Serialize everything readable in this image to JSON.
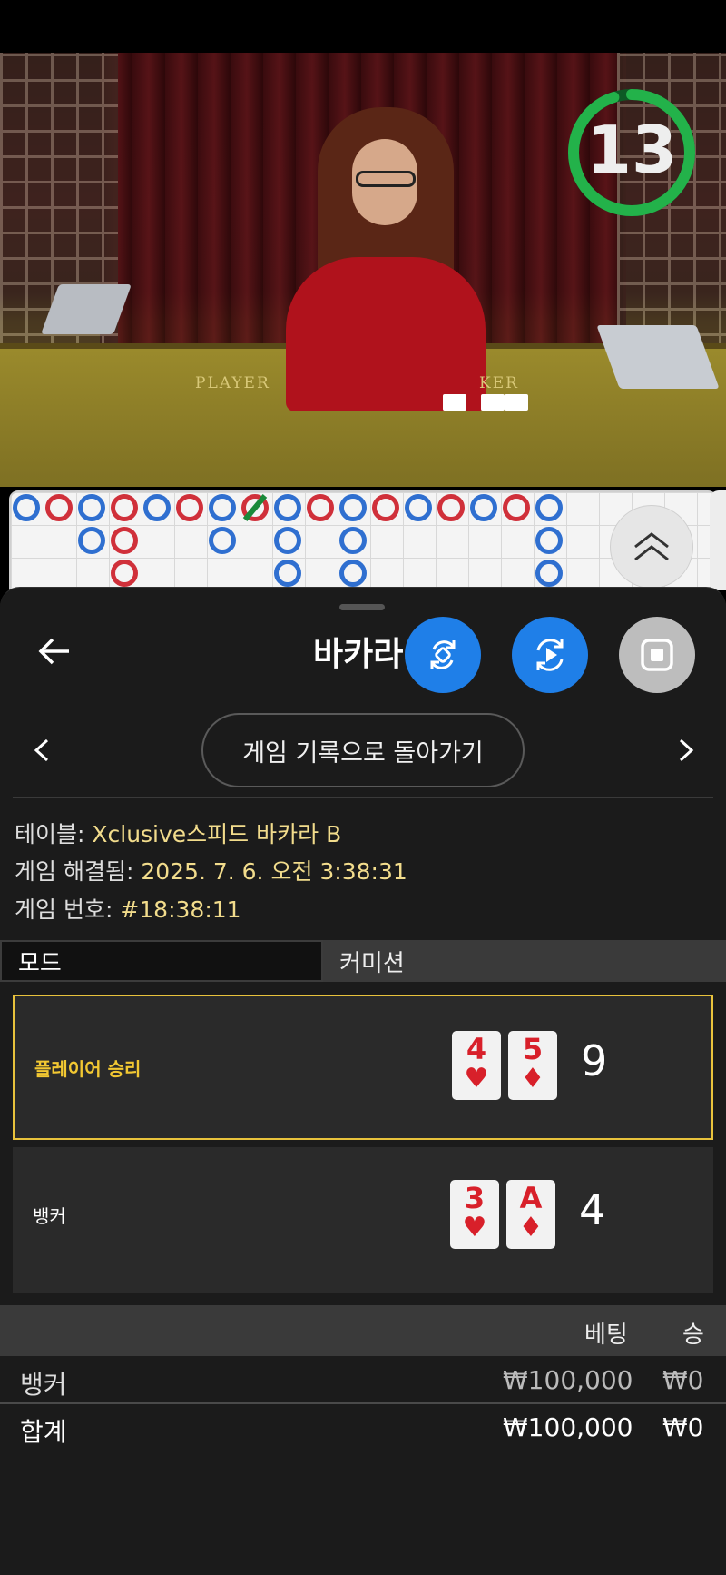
{
  "video": {
    "countdown": "13",
    "countdown_fraction": 0.95,
    "felt_player": "PLAYER",
    "felt_banker": "KER"
  },
  "roadmap": {
    "colors": {
      "player": "#2f6fd0",
      "banker": "#d0303a",
      "tie": "#1a8a3a"
    }
  },
  "panel": {
    "title": "바카라",
    "history_button": "게임 기록으로 돌아가기",
    "info": {
      "table_label": "테이블: ",
      "table_value": "Xclusive스피드 바카라 B",
      "resolved_label": "게임 해결됨: ",
      "resolved_value": "2025. 7. 6. 오전 3:38:31",
      "number_label": "게임 번호: ",
      "number_value": "#18:38:11"
    },
    "tabs": {
      "mode": "모드",
      "commission": "커미션"
    },
    "player_hand": {
      "label": "플레이어 승리",
      "cards": [
        {
          "rank": "4",
          "suit": "♥"
        },
        {
          "rank": "5",
          "suit": "♦"
        }
      ],
      "total": "9"
    },
    "banker_hand": {
      "label": "뱅커",
      "cards": [
        {
          "rank": "3",
          "suit": "♥"
        },
        {
          "rank": "A",
          "suit": "♦"
        }
      ],
      "total": "4"
    },
    "bets": {
      "header_bet": "베팅",
      "header_win": "승",
      "rows": [
        {
          "name": "뱅커",
          "bet": "₩100,000",
          "win": "₩0"
        },
        {
          "name": "합계",
          "bet": "₩100,000",
          "win": "₩0"
        }
      ]
    }
  }
}
